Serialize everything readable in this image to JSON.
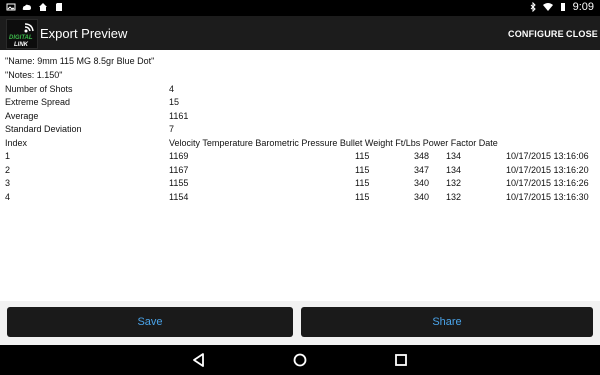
{
  "status_bar": {
    "time": "9:09",
    "icons_left": [
      "image-icon",
      "cloud-icon",
      "home-icon",
      "sd-card-icon"
    ],
    "icons_right": [
      "bluetooth-icon",
      "wifi-icon",
      "battery-icon"
    ]
  },
  "app_bar": {
    "logo_text": "DIGITAL LINK",
    "title": "Export Preview",
    "actions": [
      "CONFIGURE",
      "CLOSE"
    ]
  },
  "summary": {
    "name_line": "\"Name: 9mm 115 MG 8.5gr Blue Dot\"",
    "notes_line": "\"Notes: 1.150\"",
    "stats": [
      {
        "label": "Number of Shots",
        "value": "4"
      },
      {
        "label": "Extreme Spread",
        "value": "15"
      },
      {
        "label": "Average",
        "value": "1161"
      },
      {
        "label": "Standard Deviation",
        "value": "7"
      }
    ]
  },
  "table": {
    "index_header": "Index",
    "header_text": "Velocity Temperature Barometric Pressure Bullet Weight Ft/Lbs Power Factor Date",
    "rows": [
      {
        "index": "1",
        "velocity": "1169",
        "bullet_weight": "115",
        "ftlbs": "348",
        "power_factor": "134",
        "date": "10/17/2015 13:16:06"
      },
      {
        "index": "2",
        "velocity": "1167",
        "bullet_weight": "115",
        "ftlbs": "347",
        "power_factor": "134",
        "date": "10/17/2015 13:16:20"
      },
      {
        "index": "3",
        "velocity": "1155",
        "bullet_weight": "115",
        "ftlbs": "340",
        "power_factor": "132",
        "date": "10/17/2015 13:16:26"
      },
      {
        "index": "4",
        "velocity": "1154",
        "bullet_weight": "115",
        "ftlbs": "340",
        "power_factor": "132",
        "date": "10/17/2015 13:16:30"
      }
    ]
  },
  "buttons": {
    "save": "Save",
    "share": "Share"
  },
  "nav_bar": {
    "icons": [
      "back-icon",
      "home-icon",
      "recents-icon"
    ]
  },
  "colors": {
    "accent": "#4aa3e8",
    "logo_green": "#3cb84a"
  }
}
